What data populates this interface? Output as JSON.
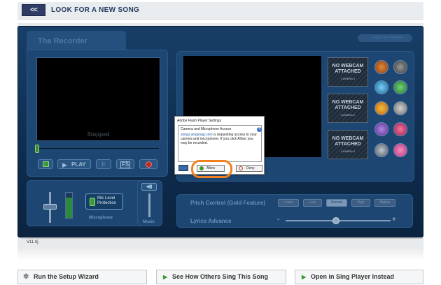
{
  "topbar": {
    "back_label": "<<",
    "title": "LOOK FOR A NEW SONG"
  },
  "recorder": {
    "tab_title": "The Recorder",
    "status": "Stopped",
    "play_label": "PLAY",
    "fs_label": "FS",
    "mic_level_label": "Mic Level Protection",
    "microphone_label": "Microphone",
    "music_label": "Music",
    "large_view_label": "Large User Window"
  },
  "cameras": [
    {
      "label": "NO WEBCAM ATTACHED",
      "name": "CAMERA 1"
    },
    {
      "label": "NO WEBCAM ATTACHED",
      "name": "CAMERA 2"
    },
    {
      "label": "NO WEBCAM ATTACHED",
      "name": "CAMERA 3"
    }
  ],
  "pitch": {
    "label": "Pitch Control (Gold Feature)",
    "buttons": [
      "Lower",
      "Low",
      "Normal",
      "High",
      "Higher"
    ]
  },
  "lyrics": {
    "label": "Lyrics Advance",
    "minus": "-",
    "plus": "+"
  },
  "version": "V11.0j",
  "flash_dialog": {
    "title": "Adobe Flash Player Settings",
    "heading": "Camera and Microphone Access",
    "site": "songs.singsnap.com",
    "message": " is requesting access to your camera and microphone. If you click Allow, you may be recorded.",
    "help": "?",
    "allow_label": "Allow",
    "deny_label": "Deny"
  },
  "bottom_buttons": [
    {
      "label": "Run the Setup Wizard"
    },
    {
      "label": "See How Others Sing This Song"
    },
    {
      "label": "Open in Sing Player Instead"
    }
  ],
  "colors": {
    "accent": "#f08020",
    "panel": "#1d4673",
    "background": "#0e2c4e"
  }
}
